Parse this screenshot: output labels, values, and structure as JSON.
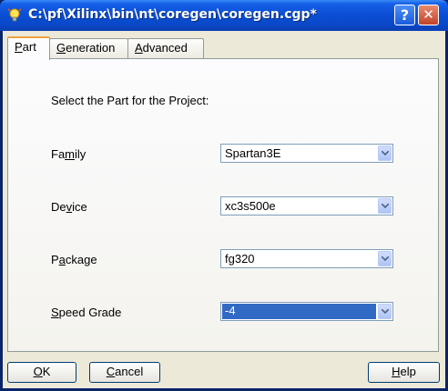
{
  "window": {
    "title": "C:\\pf\\Xilinx\\bin\\nt\\coregen\\coregen.cgp*"
  },
  "tabs": [
    {
      "pre": "",
      "key": "P",
      "post": "art",
      "active": true
    },
    {
      "pre": "",
      "key": "G",
      "post": "eneration",
      "active": false
    },
    {
      "pre": "",
      "key": "A",
      "post": "dvanced",
      "active": false
    }
  ],
  "panel": {
    "instruction": "Select the Part for the Project:",
    "fields": [
      {
        "label_pre": "Fa",
        "label_key": "m",
        "label_post": "ily",
        "value": "Spartan3E",
        "highlighted": false
      },
      {
        "label_pre": "De",
        "label_key": "v",
        "label_post": "ice",
        "value": "xc3s500e",
        "highlighted": false
      },
      {
        "label_pre": "P",
        "label_key": "a",
        "label_post": "ckage",
        "value": "fg320",
        "highlighted": false
      },
      {
        "label_pre": "",
        "label_key": "S",
        "label_post": "peed Grade",
        "value": "-4",
        "highlighted": true
      }
    ]
  },
  "buttons": {
    "ok": {
      "key": "O",
      "post": "K"
    },
    "cancel": {
      "key": "C",
      "post": "ancel"
    },
    "help": {
      "key": "H",
      "post": "elp"
    }
  },
  "icons": {
    "app": "lightbulb-icon",
    "help": "question-icon",
    "close": "close-icon",
    "dropdown": "chevron-down-icon"
  }
}
